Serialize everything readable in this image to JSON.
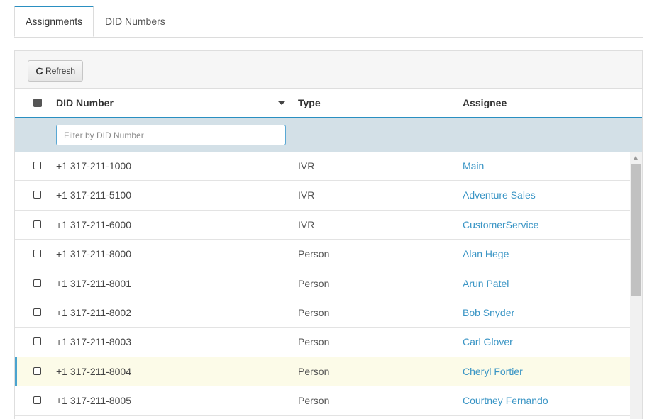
{
  "tabs": [
    {
      "label": "Assignments",
      "active": true
    },
    {
      "label": "DID Numbers",
      "active": false
    }
  ],
  "toolbar": {
    "refresh_label": "Refresh",
    "refresh_icon": "refresh-icon"
  },
  "columns": {
    "did_number": "DID Number",
    "type": "Type",
    "assignee": "Assignee",
    "sort": "descending"
  },
  "filter": {
    "placeholder": "Filter by DID Number",
    "value": ""
  },
  "rows": [
    {
      "did": "+1 317-211-1000",
      "type": "IVR",
      "assignee": "Main"
    },
    {
      "did": "+1 317-211-5100",
      "type": "IVR",
      "assignee": "Adventure Sales"
    },
    {
      "did": "+1 317-211-6000",
      "type": "IVR",
      "assignee": "CustomerService"
    },
    {
      "did": "+1 317-211-8000",
      "type": "Person",
      "assignee": "Alan Hege"
    },
    {
      "did": "+1 317-211-8001",
      "type": "Person",
      "assignee": "Arun Patel"
    },
    {
      "did": "+1 317-211-8002",
      "type": "Person",
      "assignee": "Bob Snyder"
    },
    {
      "did": "+1 317-211-8003",
      "type": "Person",
      "assignee": "Carl Glover"
    },
    {
      "did": "+1 317-211-8004",
      "type": "Person",
      "assignee": "Cheryl Fortier",
      "highlighted": true
    },
    {
      "did": "+1 317-211-8005",
      "type": "Person",
      "assignee": "Courtney Fernando"
    }
  ],
  "colors": {
    "accent": "#2a8fc1",
    "link": "#3a95c5",
    "filter_row": "#d3e0e7",
    "highlight_row": "#fcfbe8"
  }
}
